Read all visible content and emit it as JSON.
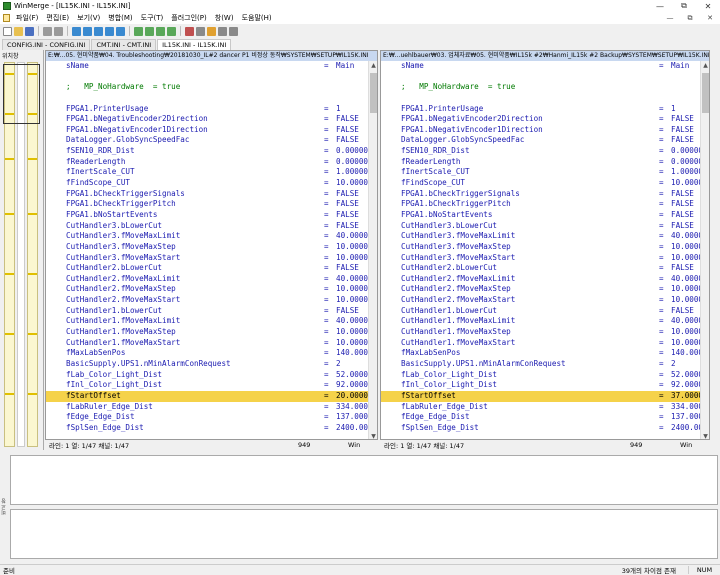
{
  "window": {
    "title": "WinMerge - [IL15K.INI - IL15K.INI]",
    "controls": [
      "—",
      "⧉",
      "✕"
    ]
  },
  "menu": {
    "items": [
      "파일(F)",
      "편집(E)",
      "보기(V)",
      "병합(M)",
      "도구(T)",
      "플러그인(P)",
      "창(W)",
      "도움말(H)"
    ],
    "right_controls": [
      "—",
      "⧉",
      "✕"
    ]
  },
  "tabs": [
    {
      "label": "CONFIG.INI - CONFIG.INI"
    },
    {
      "label": "CMT.INI - CMT.INI"
    },
    {
      "label": "IL15K.INI - IL15K.INI"
    }
  ],
  "location_pane": {
    "label": "위치창"
  },
  "left_pane": {
    "header": "E:₩...05. 현미약품₩04. Troubleshooting₩20181030_IL#2 dancer P1 비정상 동작₩SYSTEM₩SETUP₩IL15K.INI",
    "status": {
      "position": "라인: 1  열: 1/47  채널: 1/47",
      "codepage": "949",
      "eol": "Win"
    },
    "lines": [
      {
        "key": "sName",
        "val": "Main"
      },
      {
        "key": "",
        "val": ""
      },
      {
        "key": ";   MP_NoHardware  = true",
        "val": "",
        "type": "comment"
      },
      {
        "key": "",
        "val": ""
      },
      {
        "key": "FPGA1.PrinterUsage",
        "val": "1"
      },
      {
        "key": "FPGA1.bNegativEncoder2Direction",
        "val": "FALSE"
      },
      {
        "key": "FPGA1.bNegativEncoder1Direction",
        "val": "FALSE"
      },
      {
        "key": "DataLogger.GlobSyncSpeedFac",
        "val": "FALSE"
      },
      {
        "key": "fSEN10_RDR_Dist",
        "val": "0.000000"
      },
      {
        "key": "fReaderLength",
        "val": "0.000000"
      },
      {
        "key": "fInertScale_CUT",
        "val": "1.000000"
      },
      {
        "key": "fFindScope_CUT",
        "val": "10.00000"
      },
      {
        "key": "FPGA1.bCheckTriggerSignals",
        "val": "FALSE"
      },
      {
        "key": "FPGA1.bCheckTriggerPitch",
        "val": "FALSE"
      },
      {
        "key": "FPGA1.bNoStartEvents",
        "val": "FALSE"
      },
      {
        "key": "CutHandler3.bLowerCut",
        "val": "FALSE"
      },
      {
        "key": "CutHandler3.fMoveMaxLimit",
        "val": "40.00000"
      },
      {
        "key": "CutHandler3.fMoveMaxStep",
        "val": "10.00000"
      },
      {
        "key": "CutHandler3.fMoveMaxStart",
        "val": "10.00000"
      },
      {
        "key": "CutHandler2.bLowerCut",
        "val": "FALSE"
      },
      {
        "key": "CutHandler2.fMoveMaxLimit",
        "val": "40.00000"
      },
      {
        "key": "CutHandler2.fMoveMaxStep",
        "val": "10.00000"
      },
      {
        "key": "CutHandler2.fMoveMaxStart",
        "val": "10.00000"
      },
      {
        "key": "CutHandler1.bLowerCut",
        "val": "FALSE"
      },
      {
        "key": "CutHandler1.fMoveMaxLimit",
        "val": "40.00000"
      },
      {
        "key": "CutHandler1.fMoveMaxStep",
        "val": "10.00000"
      },
      {
        "key": "CutHandler1.fMoveMaxStart",
        "val": "10.00000"
      },
      {
        "key": "fMaxLabSenPos",
        "val": "140.0000"
      },
      {
        "key": "BasicSupply.UPS1.nMinAlarmConRequest",
        "val": "2"
      },
      {
        "key": "fLab_Color_Light_Dist",
        "val": "52.00000"
      },
      {
        "key": "fInl_Color_Light_Dist",
        "val": "92.00000"
      },
      {
        "key": "fStartOffset",
        "val": "20.00000",
        "type": "diff"
      },
      {
        "key": "fLabRuler_Edge_Dist",
        "val": "334.0000"
      },
      {
        "key": "fEdge_Edge_Dist",
        "val": "137.0000"
      },
      {
        "key": "fSplSen_Edge_Dist",
        "val": "2400.000"
      }
    ]
  },
  "right_pane": {
    "header": "E:₩...uehlbauer₩03. 업체자료₩05. 현미약품₩IL15k #2₩Hanmi_IL15k #2 Backup₩SYSTEM₩SETUP₩IL15K.INI",
    "status": {
      "position": "라인: 1  열: 1/47  채널: 1/47",
      "codepage": "949",
      "eol": "Win"
    },
    "lines": [
      {
        "key": "sName",
        "val": "Main"
      },
      {
        "key": "",
        "val": ""
      },
      {
        "key": ";   MP_NoHardware  = true",
        "val": "",
        "type": "comment"
      },
      {
        "key": "",
        "val": ""
      },
      {
        "key": "FPGA1.PrinterUsage",
        "val": "1"
      },
      {
        "key": "FPGA1.bNegativEncoder2Direction",
        "val": "FALSE"
      },
      {
        "key": "FPGA1.bNegativEncoder1Direction",
        "val": "FALSE"
      },
      {
        "key": "DataLogger.GlobSyncSpeedFac",
        "val": "FALSE"
      },
      {
        "key": "fSEN10_RDR_Dist",
        "val": "0.000000"
      },
      {
        "key": "fReaderLength",
        "val": "0.000000"
      },
      {
        "key": "fInertScale_CUT",
        "val": "1.000000"
      },
      {
        "key": "fFindScope_CUT",
        "val": "10.00000"
      },
      {
        "key": "FPGA1.bCheckTriggerSignals",
        "val": "FALSE"
      },
      {
        "key": "FPGA1.bCheckTriggerPitch",
        "val": "FALSE"
      },
      {
        "key": "FPGA1.bNoStartEvents",
        "val": "FALSE"
      },
      {
        "key": "CutHandler3.bLowerCut",
        "val": "FALSE"
      },
      {
        "key": "CutHandler3.fMoveMaxLimit",
        "val": "40.00000"
      },
      {
        "key": "CutHandler3.fMoveMaxStep",
        "val": "10.00000"
      },
      {
        "key": "CutHandler3.fMoveMaxStart",
        "val": "10.00000"
      },
      {
        "key": "CutHandler2.bLowerCut",
        "val": "FALSE"
      },
      {
        "key": "CutHandler2.fMoveMaxLimit",
        "val": "40.00000"
      },
      {
        "key": "CutHandler2.fMoveMaxStep",
        "val": "10.00000"
      },
      {
        "key": "CutHandler2.fMoveMaxStart",
        "val": "10.00000"
      },
      {
        "key": "CutHandler1.bLowerCut",
        "val": "FALSE"
      },
      {
        "key": "CutHandler1.fMoveMaxLimit",
        "val": "40.00000"
      },
      {
        "key": "CutHandler1.fMoveMaxStep",
        "val": "10.00000"
      },
      {
        "key": "CutHandler1.fMoveMaxStart",
        "val": "10.00000"
      },
      {
        "key": "fMaxLabSenPos",
        "val": "140.0000"
      },
      {
        "key": "BasicSupply.UPS1.nMinAlarmConRequest",
        "val": "2"
      },
      {
        "key": "fLab_Color_Light_Dist",
        "val": "52.00000"
      },
      {
        "key": "fInl_Color_Light_Dist",
        "val": "92.00000"
      },
      {
        "key": "fStartOffset",
        "val": "37.00000",
        "type": "diff"
      },
      {
        "key": "fLabRuler_Edge_Dist",
        "val": "334.0000"
      },
      {
        "key": "fEdge_Edge_Dist",
        "val": "137.0000"
      },
      {
        "key": "fSplSen_Edge_Dist",
        "val": "2400.000"
      }
    ]
  },
  "diff_pane": {
    "label": "비교 창"
  },
  "statusbar": {
    "ready": "준비",
    "diff_count": "39개의 차이점 존재",
    "numlock": "NUM"
  },
  "colors": {
    "diff_highlight": "#f5d24a",
    "key_text": "#1b1bb0",
    "comment_text": "#007a00",
    "pane_header": "#c8d8f0"
  },
  "icons": {
    "app": "winmerge-icon"
  }
}
